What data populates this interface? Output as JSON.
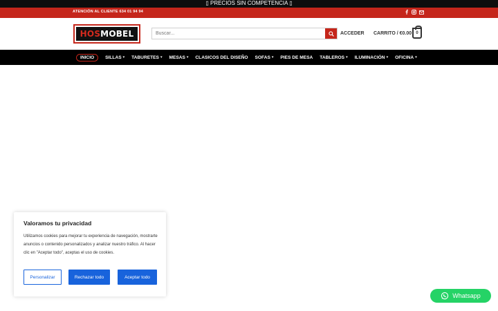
{
  "promo": {
    "text": "▯ PRECIOS SIN COMPETENCIA ▯"
  },
  "top_bar": {
    "support_text": "ATENCIÓN AL CLIENTE 634 01 94 94",
    "social_icons": [
      "facebook-icon",
      "instagram-icon",
      "email-icon"
    ]
  },
  "header": {
    "logo_left": "HOS",
    "logo_right": "MOBEL",
    "search_placeholder": "Buscar...",
    "login_label": "ACCEDER",
    "cart_label": "CARRITO / €0.00",
    "cart_count": "0"
  },
  "nav": {
    "items": [
      {
        "label": "INICIO"
      },
      {
        "label": "SILLAS"
      },
      {
        "label": "TABURETES"
      },
      {
        "label": "MESAS"
      },
      {
        "label": "CLASICOS DEL DISEÑO"
      },
      {
        "label": "SOFAS"
      },
      {
        "label": "PIES DE MESA"
      },
      {
        "label": "TABLEROS"
      },
      {
        "label": "ILUMINACIÓN"
      },
      {
        "label": "OFICINA"
      }
    ]
  },
  "cookie": {
    "title": "Valoramos tu privacidad",
    "text": "Utilizamos cookies para mejorar tu experiencia de navegación, mostrarte anuncios o contenido personalizados y analizar nuestro tráfico. Al hacer clic en \"Aceptar todo\", aceptas el uso de cookies.",
    "customize_label": "Personalizar",
    "reject_label": "Rechazar todo",
    "accept_label": "Aceptar todo"
  },
  "whatsapp": {
    "label": "Whatsapp"
  },
  "colors": {
    "brand_red": "#c5261b",
    "cookie_blue": "#1863dc",
    "whatsapp_green": "#25d366"
  }
}
